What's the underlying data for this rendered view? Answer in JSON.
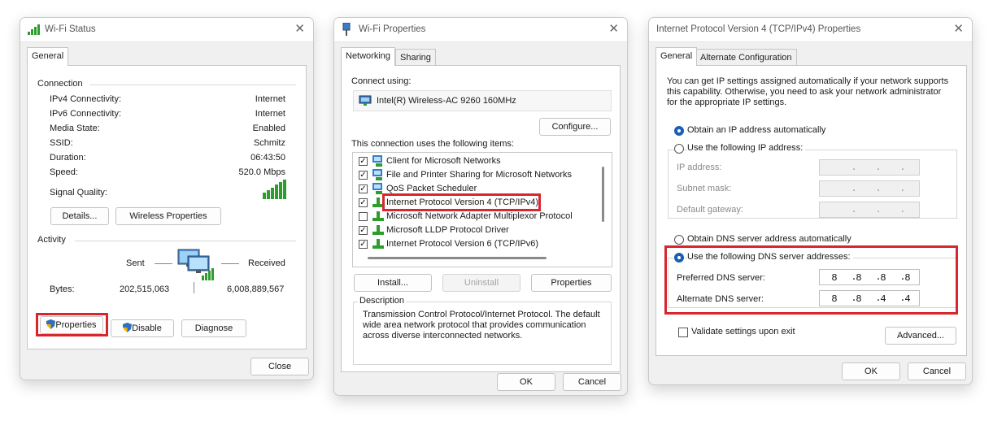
{
  "status_window": {
    "title": "Wi-Fi Status",
    "tab": "General",
    "connection_label": "Connection",
    "rows": [
      {
        "label": "IPv4 Connectivity:",
        "value": "Internet"
      },
      {
        "label": "IPv6 Connectivity:",
        "value": "Internet"
      },
      {
        "label": "Media State:",
        "value": "Enabled"
      },
      {
        "label": "SSID:",
        "value": "Schmitz"
      },
      {
        "label": "Duration:",
        "value": "06:43:50"
      },
      {
        "label": "Speed:",
        "value": "520.0 Mbps"
      }
    ],
    "signal_label": "Signal Quality:",
    "details_button": "Details...",
    "wireless_properties_button": "Wireless Properties",
    "activity_label": "Activity",
    "sent_label": "Sent",
    "received_label": "Received",
    "bytes_label": "Bytes:",
    "bytes_sent": "202,515,063",
    "bytes_received": "6,008,889,567",
    "properties_button": "Properties",
    "disable_button": "Disable",
    "diagnose_button": "Diagnose",
    "close_button": "Close"
  },
  "properties_window": {
    "title": "Wi-Fi Properties",
    "tabs": [
      "Networking",
      "Sharing"
    ],
    "connect_using_label": "Connect using:",
    "adapter_name": "Intel(R) Wireless-AC 9260 160MHz",
    "configure_button": "Configure...",
    "items_label": "This connection uses the following items:",
    "items": [
      {
        "label": "Client for Microsoft Networks",
        "checked": true
      },
      {
        "label": "File and Printer Sharing for Microsoft Networks",
        "checked": true
      },
      {
        "label": "QoS Packet Scheduler",
        "checked": true
      },
      {
        "label": "Internet Protocol Version 4 (TCP/IPv4)",
        "checked": true
      },
      {
        "label": "Microsoft Network Adapter Multiplexor Protocol",
        "checked": false
      },
      {
        "label": "Microsoft LLDP Protocol Driver",
        "checked": true
      },
      {
        "label": "Internet Protocol Version 6 (TCP/IPv6)",
        "checked": true
      }
    ],
    "install_button": "Install...",
    "uninstall_button": "Uninstall",
    "properties_button": "Properties",
    "description_label": "Description",
    "description_text": [
      "Transmission Control Protocol/Internet Protocol. The default",
      "wide area network protocol that provides communication",
      "across diverse interconnected networks."
    ],
    "ok_button": "OK",
    "cancel_button": "Cancel"
  },
  "ipv4_window": {
    "title": "Internet Protocol Version 4 (TCP/IPv4) Properties",
    "tabs": [
      "General",
      "Alternate Configuration"
    ],
    "intro_text": [
      "You can get IP settings assigned automatically if your network supports",
      "this capability. Otherwise, you need to ask your network administrator",
      "for the appropriate IP settings."
    ],
    "obtain_ip_auto": "Obtain an IP address automatically",
    "use_following_ip": "Use the following IP address:",
    "ip_address_label": "IP address:",
    "subnet_mask_label": "Subnet mask:",
    "default_gateway_label": "Default gateway:",
    "obtain_dns_auto": "Obtain DNS server address automatically",
    "use_following_dns": "Use the following DNS server addresses:",
    "preferred_dns_label": "Preferred DNS server:",
    "preferred_dns": [
      "8",
      "8",
      "8",
      "8"
    ],
    "alternate_dns_label": "Alternate DNS server:",
    "alternate_dns": [
      "8",
      "8",
      "4",
      "4"
    ],
    "validate_label": "Validate settings upon exit",
    "advanced_button": "Advanced...",
    "ok_button": "OK",
    "cancel_button": "Cancel"
  },
  "colors": {
    "highlight": "#d7262e",
    "radio_selected": "#1a5fb4",
    "signal_green": "#2e9d2e"
  }
}
